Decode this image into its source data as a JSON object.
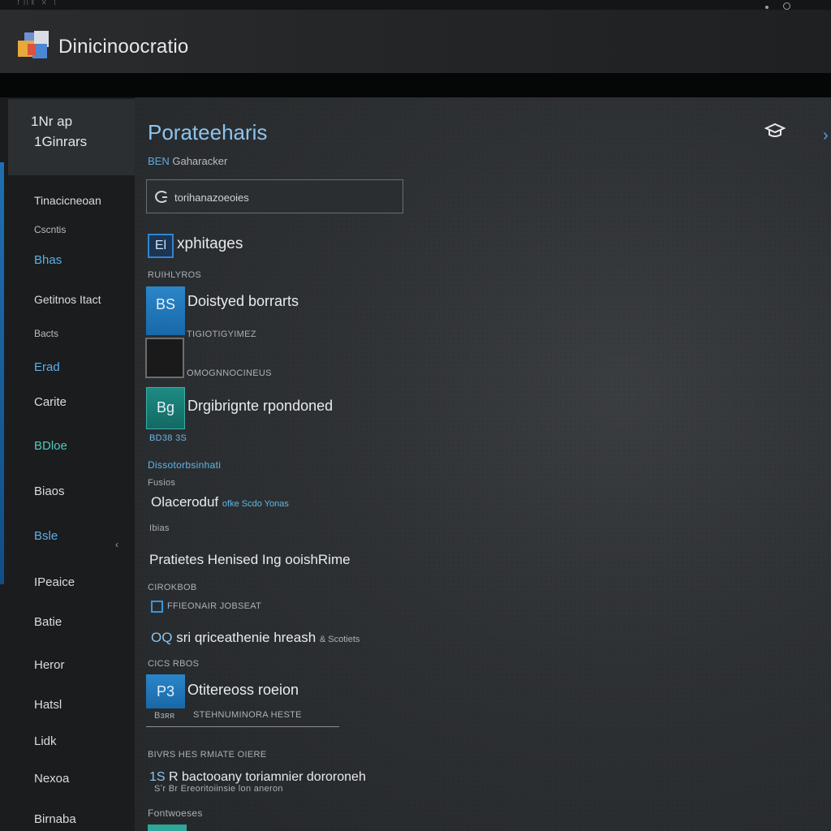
{
  "top": {
    "tiny_text": "ᚠᛖᚱ ᛟ ᛁ"
  },
  "app": {
    "title": "Dinicinoocratio"
  },
  "sidebar": {
    "header": {
      "line1": "1Nr ap",
      "line2": "1Ginrars"
    },
    "items": [
      {
        "label": "Tinacicneoan",
        "style": "normal"
      },
      {
        "label": "Cscntis",
        "style": "small"
      },
      {
        "label": "Bhas",
        "style": "blue"
      },
      {
        "label": "Getitnos Itact",
        "style": "normal"
      },
      {
        "label": "Bacts",
        "style": "small"
      },
      {
        "label": "Erad",
        "style": "blue"
      },
      {
        "label": "Carite",
        "style": "normal"
      },
      {
        "label": "BDloe",
        "style": "teal"
      },
      {
        "label": "Biaos",
        "style": "normal"
      },
      {
        "label": "Bsle",
        "style": "blue"
      },
      {
        "label": "IPeaice",
        "style": "normal"
      },
      {
        "label": "Batie",
        "style": "normal"
      },
      {
        "label": "Heror",
        "style": "normal"
      },
      {
        "label": "Hatsl",
        "style": "normal"
      },
      {
        "label": "Lidk",
        "style": "normal"
      },
      {
        "label": "Nexoa",
        "style": "normal"
      },
      {
        "label": "Birnaba",
        "style": "normal"
      }
    ],
    "expand_chevron": "‹"
  },
  "main": {
    "title": "Porateeharis",
    "subtitle_prefix": "BEN",
    "subtitle": "Gaharacker",
    "search_value": "torihanazoeoies",
    "section": {
      "badge": "El",
      "title": "xphitages"
    },
    "meta_1": "RUIHLYROS",
    "row_1": {
      "tile": "BS",
      "title": "Doistyed borrarts"
    },
    "meta_2": "TIGIOTIGYIMEZ",
    "meta_3": "OMOGNNOCINEUS",
    "row_2": {
      "tile": "Bg",
      "title": "Drgibrignte rpondoned"
    },
    "meta_4": "BD38 3S",
    "link_1": "Dissotorbsinhati",
    "meta_5": "Fusios",
    "row_3": {
      "title": "Olaceroduf",
      "suffix": "ofke Scdo Yonas"
    },
    "meta_6": "Ibias",
    "heading_2": "Pratietes Henised Ing ooishRime",
    "meta_7": "CIROKBOB",
    "checkbox_label": "FFIEONAIR JOBSEAT",
    "row_4": {
      "prefix": "OQ",
      "title": "sri qriceathenie hreash",
      "suffix": "& Scotiets"
    },
    "meta_8": "CICS RBOS",
    "row_5": {
      "tile": "P3",
      "title": "Otitereoss roeion",
      "sub": "Bɜʀʀ"
    },
    "meta_9": "STEHNUMINORA HESTE",
    "meta_10": "BIVRS HES RMIATE OIERE",
    "row_6": {
      "prefix": "1S",
      "title": "R bactooany toriamnier dororoneh",
      "sub": "Sʼr Br Ereoritoiinsie lon aneron"
    },
    "footer_label": "Fontwoeses"
  },
  "colors": {
    "accent": "#2f84d2",
    "teal": "#2ea79a",
    "sidebar": "#1a1c1e"
  }
}
